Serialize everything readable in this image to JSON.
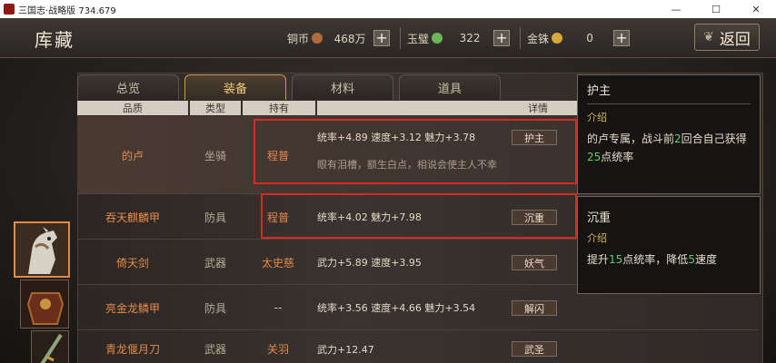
{
  "window": {
    "title": "三国志·战略版 734.679",
    "min": "—",
    "max": "☐",
    "close": "✕"
  },
  "header": {
    "title": "库藏",
    "back_label": "返回"
  },
  "resources": [
    {
      "label": "铜币",
      "value": "468万",
      "plus": "+",
      "color": "#b06a3c"
    },
    {
      "label": "玉璧",
      "value": "322",
      "plus": "+",
      "color": "#6fb35a"
    },
    {
      "label": "金铢",
      "value": "0",
      "plus": "+",
      "color": "#d6a83a"
    }
  ],
  "tabs": [
    {
      "label": "总览",
      "active": false
    },
    {
      "label": "装备",
      "active": true
    },
    {
      "label": "材料",
      "active": false
    },
    {
      "label": "道具",
      "active": false
    }
  ],
  "columns": {
    "quality": "品质",
    "type": "类型",
    "owner": "持有",
    "details": "详情"
  },
  "rows": [
    {
      "name": "的卢",
      "type": "坐骑",
      "owner": "程普",
      "stats": "统率+4.89  速度+3.12  魅力+3.78",
      "skill": "护主",
      "desc": "眼有泪槽，额生白点，相说会使主人不幸"
    },
    {
      "name": "吞天麒麟甲",
      "type": "防具",
      "owner": "程普",
      "stats": "统率+4.02  魅力+7.98",
      "skill": "沉重"
    },
    {
      "name": "倚天剑",
      "type": "武器",
      "owner": "太史慈",
      "stats": "武力+5.89  速度+3.95",
      "skill": "妖气"
    },
    {
      "name": "亮金龙鳞甲",
      "type": "防具",
      "owner": "--",
      "stats": "统率+3.56  速度+4.66  魅力+3.54",
      "skill": "解闪"
    },
    {
      "name": "青龙偃月刀",
      "type": "武器",
      "owner": "关羽",
      "stats": "武力+12.47",
      "skill": "武圣"
    }
  ],
  "tooltips": [
    {
      "name": "护主",
      "heading": "介绍",
      "text_a": "的卢专属，战斗前",
      "num_a": "2",
      "text_b": "回合自己获得",
      "num_b": "25",
      "text_c": "点统率"
    },
    {
      "name": "沉重",
      "heading": "介绍",
      "text_a": "提升",
      "num_a": "15",
      "text_b": "点统率，降低",
      "num_b": "5",
      "text_c": "速度"
    }
  ],
  "colors": {
    "accent": "#e38a4a",
    "highlight": "#d62a26",
    "green": "#5fcf5e"
  }
}
